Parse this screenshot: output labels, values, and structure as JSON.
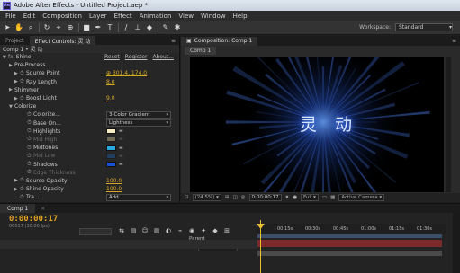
{
  "window": {
    "app_icon": "Ae",
    "title": "Adobe After Effects - Untitled Project.aep *"
  },
  "menu": [
    "File",
    "Edit",
    "Composition",
    "Layer",
    "Effect",
    "Animation",
    "View",
    "Window",
    "Help"
  ],
  "toolbar": {
    "workspace_label": "Workspace:",
    "workspace_value": "Standard"
  },
  "left_panel": {
    "tabs": [
      "Project",
      "Effect Controls: 灵 动"
    ],
    "menu_glyph": "≡",
    "header": "Comp 1 • 灵 动",
    "effect_name": "Shine",
    "effect_links": [
      "Reset",
      "Register",
      "About..."
    ],
    "rows": [
      {
        "label": "Pre-Process",
        "kind": "group"
      },
      {
        "label": "Source Point",
        "kind": "point",
        "value": "301.4, 174.0"
      },
      {
        "label": "Ray Length",
        "kind": "number",
        "value": "8.0"
      },
      {
        "label": "Shimmer",
        "kind": "group"
      },
      {
        "label": "Boost Light",
        "kind": "number",
        "value": "9.0"
      },
      {
        "label": "Colorize",
        "kind": "group-open"
      },
      {
        "label": "Colorize...",
        "kind": "dropdown",
        "value": "3-Color Gradient"
      },
      {
        "label": "Base On...",
        "kind": "dropdown",
        "value": "Lightness"
      },
      {
        "label": "Highlights",
        "kind": "color",
        "color": "#f4ecc0"
      },
      {
        "label": "Mid High",
        "kind": "color-dim",
        "color": "#f3e6a0"
      },
      {
        "label": "Midtones",
        "kind": "color",
        "color": "#2aa8e0"
      },
      {
        "label": "Mid Low",
        "kind": "color-dim",
        "color": "#1a6fd0"
      },
      {
        "label": "Shadows",
        "kind": "color",
        "color": "#1a4fd8"
      },
      {
        "label": "Edge Thickness",
        "kind": "dim"
      },
      {
        "label": "Source Opacity",
        "kind": "number",
        "value": "100.0"
      },
      {
        "label": "Shine Opacity",
        "kind": "number",
        "value": "100.0"
      },
      {
        "label": "Tra...",
        "kind": "dropdown",
        "value": "Add"
      }
    ]
  },
  "comp_panel": {
    "tab": "Composition: Comp 1",
    "subtab": "Comp 1",
    "comp_text": "灵 动",
    "zoom": "(24.5%)",
    "timecode": "0:00:00:17",
    "resolution": "Full",
    "camera": "Active Camera"
  },
  "timeline": {
    "tab": "Comp 1",
    "current_time": "0:00:00:17",
    "sub_time": "00017 (30.00 fps)",
    "parent_header": "Parent",
    "parent_value": "None",
    "ruler_ticks": [
      "00:15s",
      "00:30s",
      "00:45s",
      "01:00s",
      "01:15s",
      "01:30s"
    ]
  },
  "colors": {
    "accent_timecode": "#e0a020",
    "value_orange": "#d9a728",
    "layer_bar": "#7a2a2a"
  }
}
